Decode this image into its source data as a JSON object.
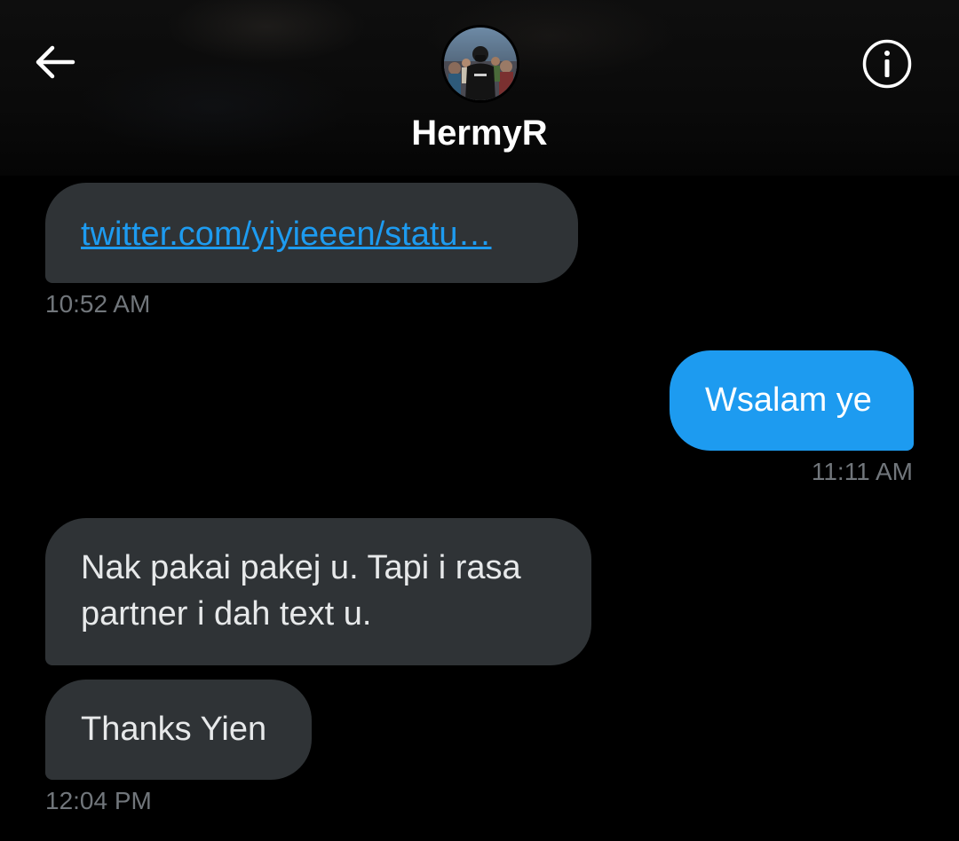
{
  "header": {
    "contact_name": "HermyR",
    "icons": {
      "back": "arrow-left-icon",
      "info": "info-circle-icon"
    }
  },
  "messages": [
    {
      "direction": "incoming",
      "type": "link",
      "text": "twitter.com/yiyieeen/statu…",
      "timestamp": "10:52 AM"
    },
    {
      "direction": "outgoing",
      "type": "text",
      "text": "Wsalam ye",
      "timestamp": "11:11 AM"
    },
    {
      "direction": "incoming",
      "type": "text",
      "text": "Nak pakai pakej u. Tapi i rasa partner i dah text u."
    },
    {
      "direction": "incoming",
      "type": "text",
      "text": "Thanks Yien",
      "timestamp": "12:04 PM"
    }
  ],
  "colors": {
    "background": "#000000",
    "incoming_bubble": "#2f3336",
    "outgoing_bubble": "#1d9bf0",
    "link": "#1d9bf0",
    "timestamp": "#71767b"
  }
}
